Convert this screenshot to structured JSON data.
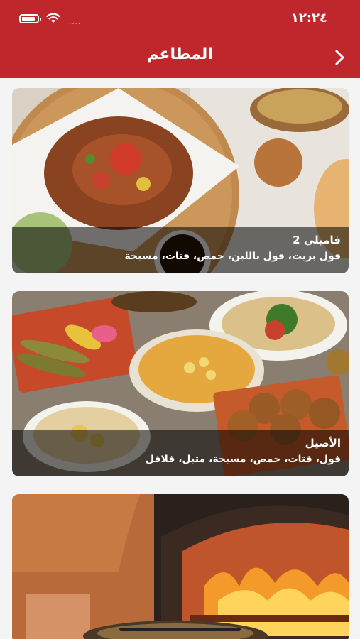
{
  "status_bar": {
    "time": "١٢:٢٤",
    "signal_dots": "....."
  },
  "header": {
    "title": "المطاعم"
  },
  "restaurants": [
    {
      "name": "فاميلي 2",
      "items": "فول بزيت، فول باللبن، حمص، فتات، مسبحة"
    },
    {
      "name": "الأصيل",
      "items": "فول، فتات، حمص، مسبحة، متبل، فلافل"
    },
    {
      "name": "",
      "items": ""
    }
  ],
  "theme": {
    "header_color": "#c0272d"
  }
}
